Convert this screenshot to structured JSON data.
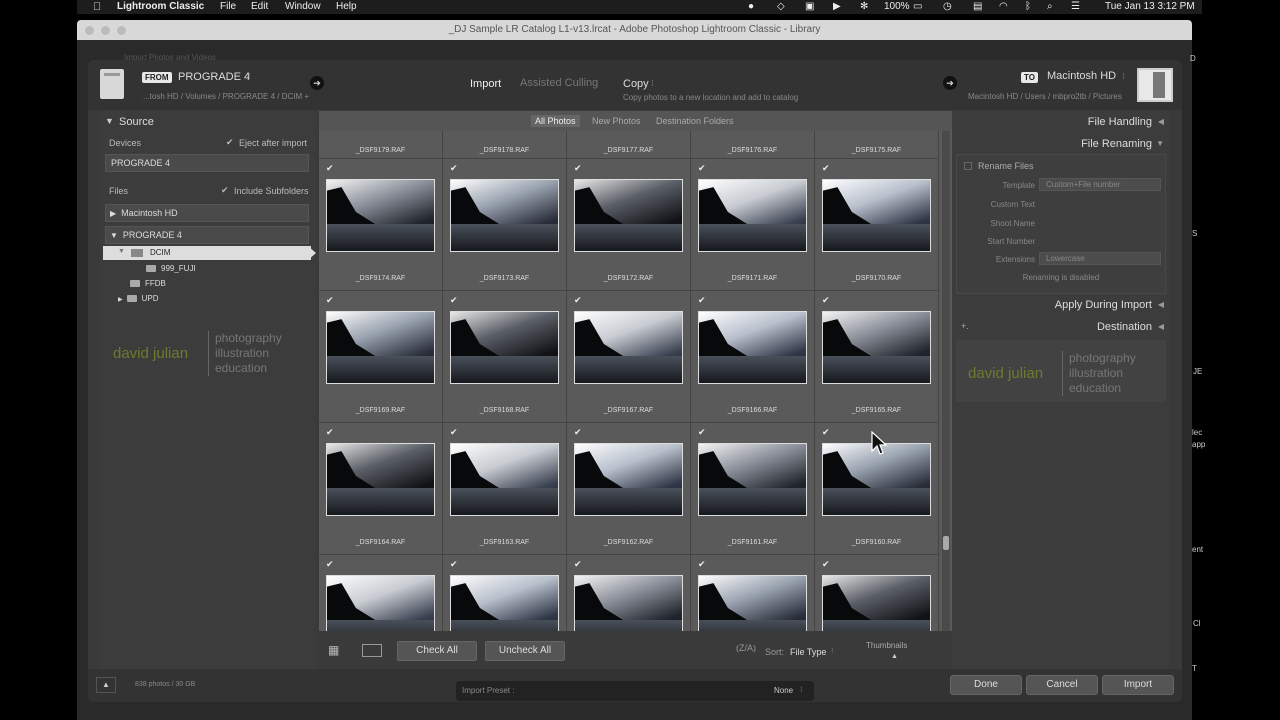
{
  "menubar": {
    "app_name": "Lightroom Classic",
    "menus": [
      "File",
      "Edit",
      "Window",
      "Help"
    ],
    "battery": "100%",
    "datetime": "Tue Jan 13  3:12 PM"
  },
  "window": {
    "title": "_DJ Sample LR Catalog L1-v13.lrcat - Adobe Photoshop Lightroom Classic - Library",
    "behind_text": "Import Photos and Videos"
  },
  "topbar": {
    "from_badge": "FROM",
    "from_name": "PROGRADE 4",
    "from_path": "...tosh HD / Volumes / PROGRADE 4 / DCIM +",
    "modes": [
      "Import",
      "Assisted Culling"
    ],
    "copy_label": "Copy",
    "copy_desc": "Copy photos to a new location and add to catalog",
    "to_badge": "TO",
    "to_name": "Macintosh HD",
    "to_path": "Macintosh HD / Users / mbpro2tb / Pictures"
  },
  "source_panel": {
    "title": "Source",
    "devices_label": "Devices",
    "eject_label": "Eject after import",
    "device_name": "PROGRADE 4",
    "files_label": "Files",
    "include_subfolders": "Include Subfolders",
    "volumes": [
      "Macintosh HD",
      "PROGRADE 4"
    ],
    "folders": [
      "DCIM",
      "999_FUJI",
      "FFDB",
      "UPD"
    ]
  },
  "logo": {
    "name": "david julian",
    "lines": [
      "photography",
      "illustration",
      "education"
    ]
  },
  "grid": {
    "tabs": [
      "All Photos",
      "New Photos",
      "Destination Folders"
    ],
    "top_row_names": [
      "_DSF9179.RAF",
      "_DSF9178.RAF",
      "_DSF9177.RAF",
      "_DSF9176.RAF",
      "_DSF9175.RAF"
    ],
    "rows": [
      [
        "_DSF9174.RAF",
        "_DSF9173.RAF",
        "_DSF9172.RAF",
        "_DSF9171.RAF",
        "_DSF9170.RAF"
      ],
      [
        "_DSF9169.RAF",
        "_DSF9168.RAF",
        "_DSF9167.RAF",
        "_DSF9166.RAF",
        "_DSF9165.RAF"
      ],
      [
        "_DSF9164.RAF",
        "_DSF9163.RAF",
        "_DSF9162.RAF",
        "_DSF9161.RAF",
        "_DSF9160.RAF"
      ]
    ],
    "check_mark": "✔"
  },
  "grid_toolbar": {
    "check_all": "Check All",
    "uncheck_all": "Uncheck All",
    "sort_label": "Sort:",
    "sort_value": "File Type",
    "thumbnails_label": "Thumbnails"
  },
  "right_panel": {
    "file_handling": "File Handling",
    "file_renaming": "File Renaming",
    "rename_files": "Rename Files",
    "template_label": "Template",
    "template_value": "Custom+File number",
    "custom_text": "Custom Text",
    "shoot_name": "Shoot Name",
    "start_number": "Start Number",
    "extensions_label": "Extensions",
    "extensions_value": "Lowercase",
    "renaming_disabled": "Renaming is disabled",
    "apply_during_import": "Apply During Import",
    "destination": "Destination",
    "plus": "+."
  },
  "bottombar": {
    "photo_count": "838 photos / 30 GB",
    "import_preset_label": "Import Preset :",
    "import_preset_value": "None",
    "done": "Done",
    "cancel": "Cancel",
    "import": "Import"
  },
  "side_fragments": [
    "D",
    "S",
    "JE",
    "lec",
    "app",
    "ent",
    "Cl",
    "T"
  ]
}
